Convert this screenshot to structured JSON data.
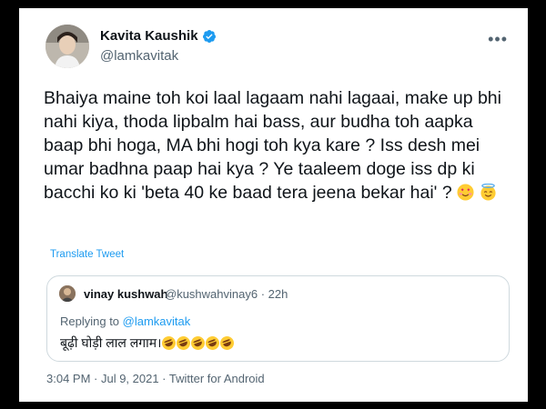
{
  "tweet": {
    "author": {
      "name": "Kavita Kaushik",
      "handle": "@lamkavitak",
      "verified": true,
      "avatar_icon": "profile-photo"
    },
    "text": "Bhaiya maine toh koi laal lagaam nahi lagaai, make up bhi nahi kiya, thoda lipbalm hai bass, aur budha toh aapka baap bhi hoga, MA bhi hogi toh kya kare ? Iss desh mei umar badhna paap hai kya ? Ye taaleem doge iss dp ki bacchi ko ki 'beta 40 ke baad tera jeena bekar hai' ?",
    "emojis": [
      "smiling-face-with-heart-eyes",
      "smiling-face-with-halo"
    ],
    "translate_label": "Translate Tweet",
    "timestamp": "3:04 PM · Jul 9, 2021 · Twitter for Android",
    "more_icon": "more-options-icon"
  },
  "quoted_tweet": {
    "author_name": "vinay kushwah",
    "handle_time": "@kushwahvinay6 · 22h",
    "replying_prefix": "Replying to ",
    "replying_to": "@lamkavitak",
    "text": "बूढ़ी घोड़ी लाल लगाम।",
    "emoji_count": 5,
    "emoji_icon": "rolling-on-floor-laughing-icon"
  },
  "colors": {
    "text": "#0f1419",
    "secondary": "#536471",
    "link": "#1d9bf0",
    "border": "#cfd9de"
  }
}
